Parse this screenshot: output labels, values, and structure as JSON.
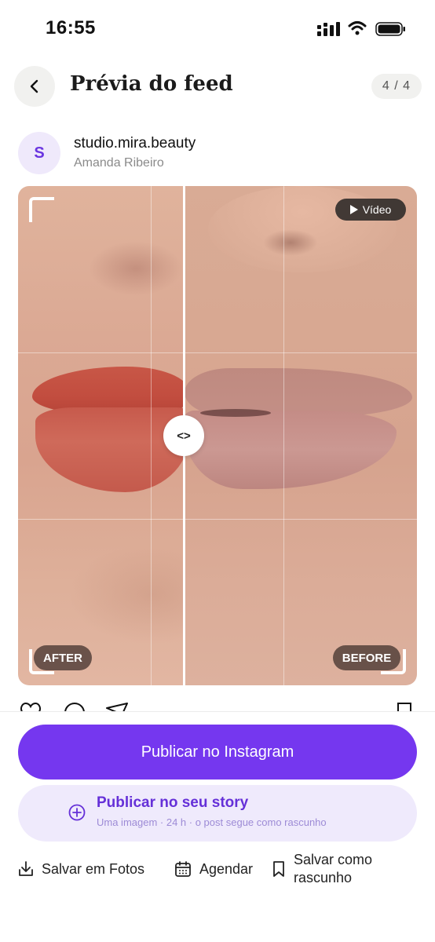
{
  "status_bar": {
    "time": "16:55"
  },
  "header": {
    "title": "Prévia do feed",
    "counter": "4 / 4"
  },
  "profile": {
    "avatar_letter": "S",
    "username": "studio.mira.beauty",
    "name": "Amanda Ribeiro"
  },
  "media": {
    "video_badge": "Vídeo",
    "after_label": "AFTER",
    "before_label": "BEFORE",
    "slider_symbol": "<>"
  },
  "sheet": {
    "publish_button": "Publicar no Instagram",
    "story_title": "Publicar no seu story",
    "story_subtitle": "Uma imagem · 24 h · o post segue como rascunho",
    "save_photos": "Salvar em Fotos",
    "schedule": "Agendar",
    "draft_line1": "Salvar como",
    "draft_line2": "rascunho"
  },
  "colors": {
    "accent": "#7537ef",
    "story_bg": "#efeafc",
    "story_text": "#6530d8"
  }
}
